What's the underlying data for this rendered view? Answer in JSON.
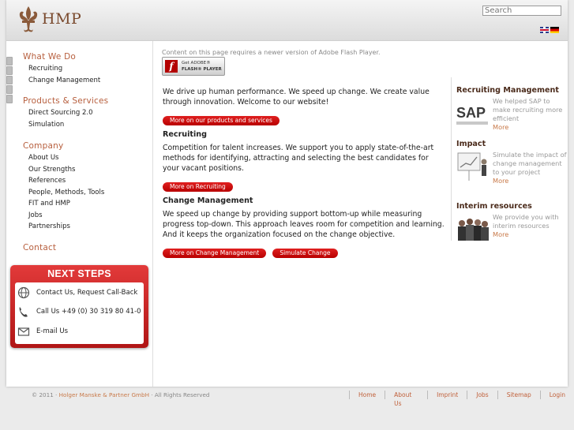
{
  "header": {
    "logo_text": "HMP",
    "search_placeholder": "Search",
    "languages": [
      "English",
      "Deutsch"
    ]
  },
  "sidebar": {
    "groups": [
      {
        "title": "What We Do",
        "items": [
          "Recruiting",
          "Change Management"
        ]
      },
      {
        "title": "Products & Services",
        "items": [
          "Direct Sourcing 2.0",
          "Simulation"
        ]
      },
      {
        "title": "Company",
        "items": [
          "About Us",
          "Our Strengths",
          "References",
          "People, Methods, Tools",
          "FIT and HMP",
          "Jobs",
          "Partnerships"
        ]
      },
      {
        "title": "Contact",
        "items": []
      }
    ]
  },
  "next_steps": {
    "title": "NEXT STEPS",
    "items": [
      {
        "icon": "globe-icon",
        "label": "Contact Us, Request Call-Back"
      },
      {
        "icon": "phone-icon",
        "label": "Call Us +49 (0) 30 319 80 41-0"
      },
      {
        "icon": "mail-icon",
        "label": "E-mail Us"
      }
    ]
  },
  "main": {
    "flash_note": "Content on this page requires a newer version of Adobe Flash Player.",
    "flash_badge_line1": "Get ADOBE®",
    "flash_badge_line2": "FLASH® PLAYER",
    "intro": "We drive up human performance. We speed up change. We create value through innovation. Welcome to our website!",
    "intro_button": "More on our products and services",
    "recruiting_heading": "Recruiting",
    "recruiting_text": "Competition for talent increases. We support you to apply state-of-the-art methods for identifying, attracting and selecting the best candidates for your vacant positions.",
    "recruiting_button": "More on Recruiting",
    "change_heading": "Change Management",
    "change_text": "We speed up change by providing support bottom-up while measuring progress top-down. This approach leaves room for competition and learning. And it keeps the organization focused on the change objective.",
    "change_button": "More on Change Management",
    "simulate_button": "Simulate Change"
  },
  "right_column": [
    {
      "title": "Recruiting Management",
      "text": "We helped SAP to make recruiting more efficient",
      "more": "More"
    },
    {
      "title": "Impact",
      "text": "Simulate the impact of change management to your project",
      "more": "More"
    },
    {
      "title": "Interim resources",
      "text": "We provide you with interim resources",
      "more": "More"
    }
  ],
  "footer": {
    "copyright_prefix": "© 2011 · ",
    "copyright_brand": "Holger Manske & Partner GmbH",
    "copyright_suffix": " · All Rights Reserved",
    "links": [
      "Home",
      "About Us",
      "Imprint",
      "Jobs",
      "Sitemap",
      "Login"
    ]
  },
  "colors": {
    "accent_red": "#c00000",
    "nav_heading": "#b75f3e",
    "link_orange": "#c87a4a"
  }
}
